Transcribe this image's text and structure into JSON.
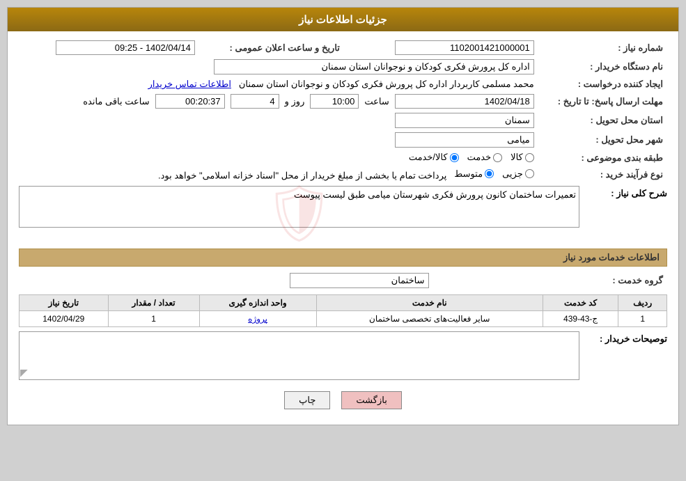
{
  "header": {
    "title": "جزئیات اطلاعات نیاز"
  },
  "fields": {
    "request_number_label": "شماره نیاز :",
    "request_number_value": "1102001421000001",
    "announcement_datetime_label": "تاریخ و ساعت اعلان عمومی :",
    "announcement_datetime_value": "1402/04/14 - 09:25",
    "buyer_org_label": "نام دستگاه خریدار :",
    "buyer_org_value": "اداره کل پرورش فکری کودکان و نوجوانان استان سمنان",
    "creator_label": "ایجاد کننده درخواست :",
    "creator_value": "محمد مسلمی کاربردار اداره کل پرورش فکری کودکان و نوجوانان استان سمنان",
    "contact_link": "اطلاعات تماس خریدار",
    "response_deadline_label": "مهلت ارسال پاسخ: تا تاریخ :",
    "response_date_value": "1402/04/18",
    "response_time_label": "ساعت",
    "response_time_value": "10:00",
    "response_days_label": "روز و",
    "response_days_value": "4",
    "remaining_time_label": "ساعت باقی مانده",
    "remaining_time_value": "00:20:37",
    "delivery_province_label": "استان محل تحویل :",
    "delivery_province_value": "سمنان",
    "delivery_city_label": "شهر محل تحویل :",
    "delivery_city_value": "میامی",
    "subject_label": "طبقه بندی موضوعی :",
    "subject_options": [
      "کالا",
      "خدمت",
      "کالا/خدمت"
    ],
    "subject_selected": "کالا/خدمت",
    "purchase_type_label": "نوع فرآیند خرید :",
    "purchase_type_options": [
      "جزیی",
      "متوسط"
    ],
    "purchase_type_note": "پرداخت تمام یا بخشی از مبلغ خریدار از محل \"اسناد خزانه اسلامی\" خواهد بود.",
    "need_description_label": "شرح کلی نیاز :",
    "need_description_value": "تعمیرات ساختمان کانون پرورش فکری شهرستان میامی طبق لیست پیوست",
    "services_section_title": "اطلاعات خدمات مورد نیاز",
    "service_group_label": "گروه خدمت :",
    "service_group_value": "ساختمان",
    "table": {
      "columns": [
        "ردیف",
        "کد خدمت",
        "نام خدمت",
        "واحد اندازه گیری",
        "تعداد / مقدار",
        "تاریخ نیاز"
      ],
      "rows": [
        {
          "row_num": "1",
          "service_code": "ج-43-439",
          "service_name": "سایر فعالیت‌های تخصصی ساختمان",
          "unit": "پروژه",
          "quantity": "1",
          "need_date": "1402/04/29"
        }
      ]
    },
    "buyer_description_label": "توصیحات خریدار :",
    "buyer_description_value": ""
  },
  "buttons": {
    "print_label": "چاپ",
    "back_label": "بازگشت"
  }
}
